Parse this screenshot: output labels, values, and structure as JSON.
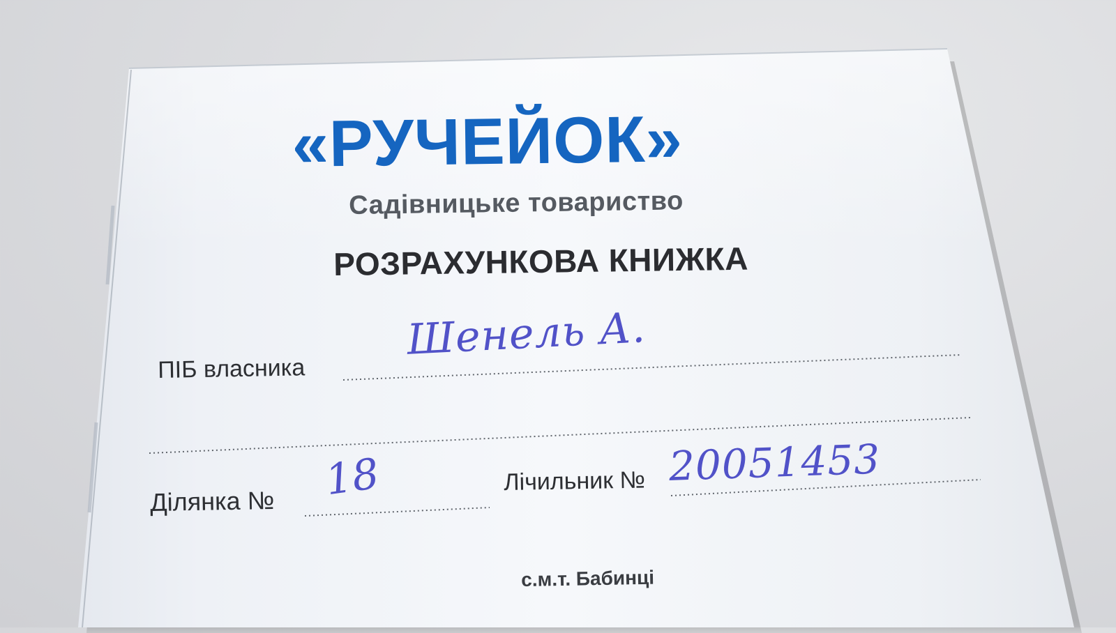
{
  "booklet": {
    "brand": "«РУЧЕЙОК»",
    "subtitle": "Садівницьке товариство",
    "title": "РОЗРАХУНКОВА КНИЖКА",
    "fields": {
      "owner_label": "ПІБ власника",
      "owner_value": "Шенель А.",
      "plot_label": "Ділянка №",
      "plot_value": "18",
      "meter_label": "Лічильник №",
      "meter_value": "20051453"
    },
    "location": "с.м.т. Бабинці"
  },
  "colors": {
    "brand_blue": "#1565c0",
    "subtitle_gray": "#555a61",
    "title_dark": "#2b2c30",
    "ink_blue": "#5152c8",
    "paper": "#f6f8fb",
    "background": "#dcdde0"
  }
}
